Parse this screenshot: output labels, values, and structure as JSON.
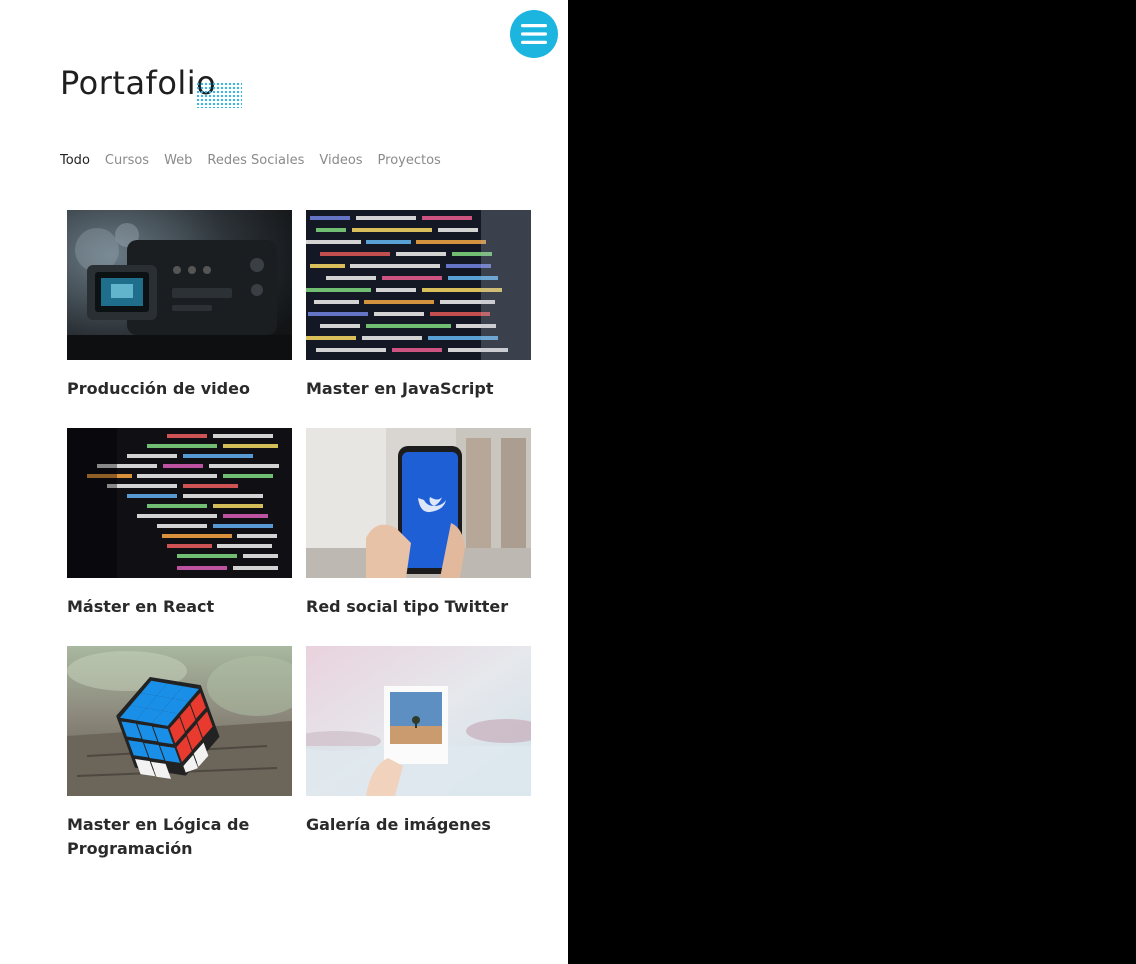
{
  "page": {
    "title": "Portafolio"
  },
  "filters": [
    {
      "label": "Todo"
    },
    {
      "label": "Cursos"
    },
    {
      "label": "Web"
    },
    {
      "label": "Redes Sociales"
    },
    {
      "label": "Videos"
    },
    {
      "label": "Proyectos"
    }
  ],
  "active_filter": "Todo",
  "menu": {
    "icon": "hamburger-menu-icon"
  },
  "colors": {
    "accent": "#1cb5e0",
    "dots": "#29b6e2",
    "text": "#1f1f1f",
    "muted": "#8a8a8a"
  },
  "projects": [
    {
      "title": "Producción de video",
      "image": "video-camera-photo"
    },
    {
      "title": "Master en JavaScript",
      "image": "javascript-code-photo"
    },
    {
      "title": "Máster en React",
      "image": "react-code-photo"
    },
    {
      "title": "Red social tipo Twitter",
      "image": "twitter-phone-photo"
    },
    {
      "title": "Master en Lógica de Programación",
      "image": "rubiks-cube-photo"
    },
    {
      "title": "Galería de imágenes",
      "image": "polaroid-photo"
    }
  ]
}
